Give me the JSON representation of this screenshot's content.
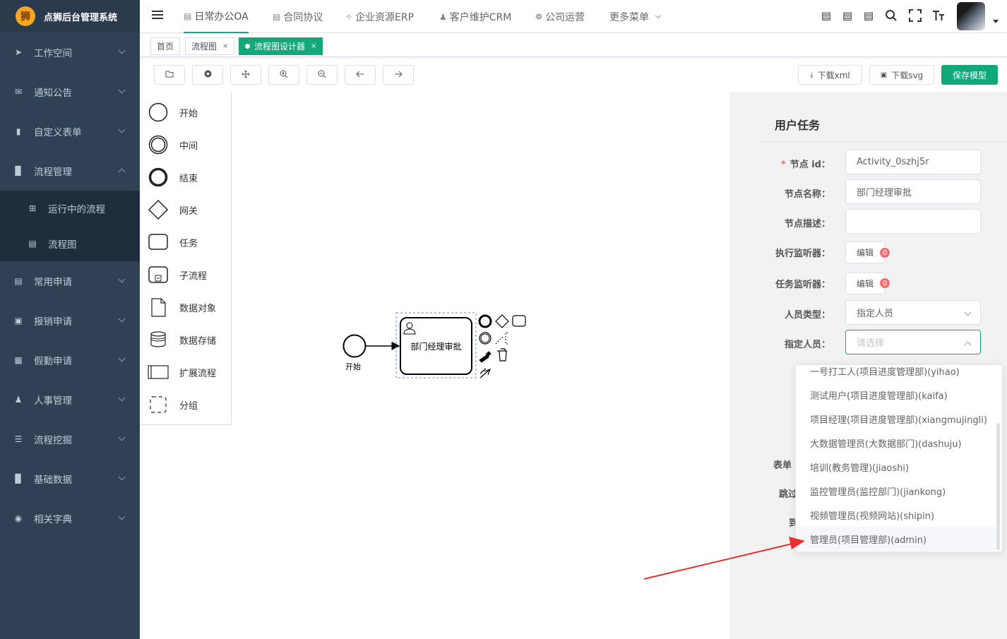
{
  "app": {
    "title": "点狮后台管理系统",
    "logo_char": "狮"
  },
  "sidebar": {
    "items": [
      {
        "label": "工作空间",
        "icon": "paper-plane-icon"
      },
      {
        "label": "通知公告",
        "icon": "envelope-icon"
      },
      {
        "label": "自定义表单",
        "icon": "book-icon"
      },
      {
        "label": "流程管理",
        "icon": "bar-chart-icon",
        "expanded": true
      },
      {
        "label": "常用申请",
        "icon": "document-icon"
      },
      {
        "label": "报销申请",
        "icon": "image-icon"
      },
      {
        "label": "假勤申请",
        "icon": "table-icon"
      },
      {
        "label": "人事管理",
        "icon": "users-icon"
      },
      {
        "label": "流程挖掘",
        "icon": "list-icon"
      },
      {
        "label": "基础数据",
        "icon": "bar-chart-icon"
      },
      {
        "label": "相关字典",
        "icon": "dashboard-icon"
      }
    ],
    "subitems": [
      {
        "label": "运行中的流程",
        "icon": "grid-icon"
      },
      {
        "label": "流程图",
        "icon": "file-icon"
      }
    ]
  },
  "topnav": {
    "items": [
      {
        "label": "日常办公OA",
        "active": true
      },
      {
        "label": "合同协议"
      },
      {
        "label": "企业资源ERP"
      },
      {
        "label": "客户维护CRM"
      },
      {
        "label": "公司运营"
      },
      {
        "label": "更多菜单"
      }
    ]
  },
  "tags": {
    "items": [
      {
        "label": "首页"
      },
      {
        "label": "流程图",
        "closable": true
      },
      {
        "label": "流程图设计器",
        "closable": true,
        "active": true
      }
    ],
    "close_glyph": "×"
  },
  "toolbar": {
    "download_xml": "下载xml",
    "download_svg": "下载svg",
    "save": "保存模型"
  },
  "palette": {
    "items": [
      {
        "label": "开始"
      },
      {
        "label": "中间"
      },
      {
        "label": "结束"
      },
      {
        "label": "网关"
      },
      {
        "label": "任务"
      },
      {
        "label": "子流程"
      },
      {
        "label": "数据对象"
      },
      {
        "label": "数据存储"
      },
      {
        "label": "扩展流程"
      },
      {
        "label": "分组"
      }
    ]
  },
  "diagram": {
    "start_label": "开始",
    "task_label": "部门经理审批"
  },
  "panel": {
    "title": "用户任务",
    "node_id_label": "节点 id：",
    "node_id_value": "Activity_0szhj5r",
    "node_name_label": "节点名称：",
    "node_name_value": "部门经理审批",
    "node_desc_label": "节点描述：",
    "node_desc_value": "",
    "exec_listener_label": "执行监听器：",
    "task_listener_label": "任务监听器：",
    "edit_label": "编辑",
    "exec_listener_count": "0",
    "task_listener_count": "0",
    "person_type_label": "人员类型：",
    "person_type_value": "指定人员",
    "assignee_label": "指定人员：",
    "assignee_placeholder": "请选择",
    "partial_labels": [
      "表单",
      "跳过",
      "到"
    ]
  },
  "dropdown": {
    "options": [
      "一号打工人(项目进度管理部)(yihao)",
      "测试用户(项目进度管理部)(kaifa)",
      "项目经理(项目进度管理部)(xiangmujingli)",
      "大数据管理员(大数据部门)(dashuju)",
      "培训(教务管理)(jiaoshi)",
      "监控管理员(监控部门)(jiankong)",
      "视频管理员(视频网站)(shipin)",
      "管理员(项目管理部)(admin)"
    ],
    "hovered_index": 7
  },
  "colors": {
    "primary": "#13a87a",
    "sidebar_bg": "#304156",
    "annotation_arrow": "#e8302f"
  }
}
